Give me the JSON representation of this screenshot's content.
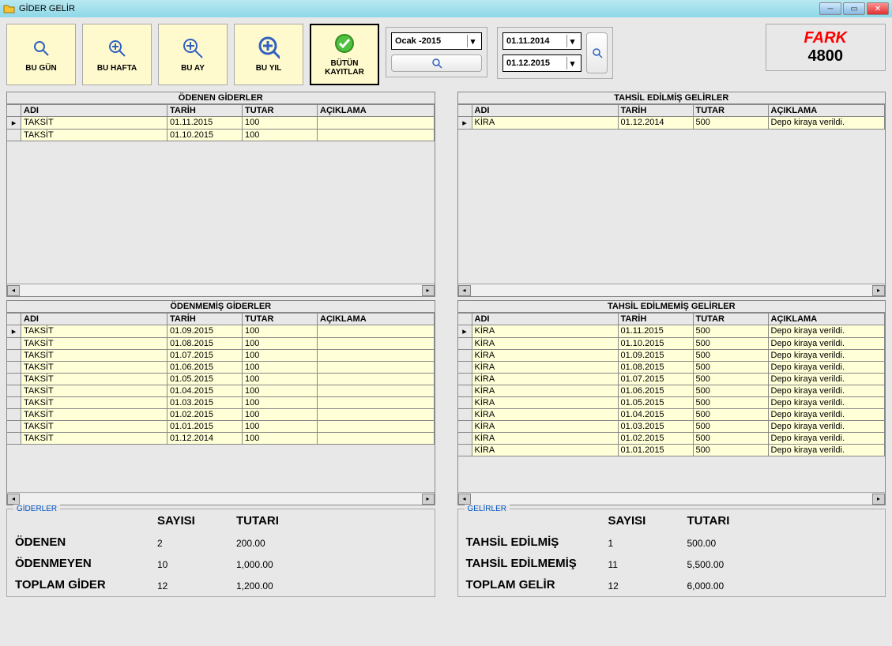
{
  "window": {
    "title": "GİDER GELİR"
  },
  "toolbar": {
    "bugun": "BU GÜN",
    "buhafta": "BU HAFTA",
    "buay": "BU AY",
    "buyil": "BU YIL",
    "butun": "BÜTÜN KAYITLAR"
  },
  "filters": {
    "month_year": "Ocak  -2015",
    "date_from": "01.11.2014",
    "date_to": "01.12.2015"
  },
  "fark": {
    "label": "FARK",
    "value": "4800"
  },
  "grid_headers": {
    "adi": "ADI",
    "tarih": "TARİH",
    "tutar": "TUTAR",
    "aciklama": "AÇIKLAMA"
  },
  "grids": {
    "odenen_giderler": {
      "title": "ÖDENEN GİDERLER",
      "rows": [
        {
          "adi": "TAKSİT",
          "tarih": "01.11.2015",
          "tutar": "100",
          "aciklama": ""
        },
        {
          "adi": "TAKSİT",
          "tarih": "01.10.2015",
          "tutar": "100",
          "aciklama": ""
        }
      ]
    },
    "tahsil_edilmis": {
      "title": "TAHSİL EDİLMİŞ GELİRLER",
      "rows": [
        {
          "adi": "KİRA",
          "tarih": "01.12.2014",
          "tutar": "500",
          "aciklama": "Depo kiraya verildi."
        }
      ]
    },
    "odenmemis_giderler": {
      "title": "ÖDENMEMİŞ GİDERLER",
      "rows": [
        {
          "adi": "TAKSİT",
          "tarih": "01.09.2015",
          "tutar": "100",
          "aciklama": ""
        },
        {
          "adi": "TAKSİT",
          "tarih": "01.08.2015",
          "tutar": "100",
          "aciklama": ""
        },
        {
          "adi": "TAKSİT",
          "tarih": "01.07.2015",
          "tutar": "100",
          "aciklama": ""
        },
        {
          "adi": "TAKSİT",
          "tarih": "01.06.2015",
          "tutar": "100",
          "aciklama": ""
        },
        {
          "adi": "TAKSİT",
          "tarih": "01.05.2015",
          "tutar": "100",
          "aciklama": ""
        },
        {
          "adi": "TAKSİT",
          "tarih": "01.04.2015",
          "tutar": "100",
          "aciklama": ""
        },
        {
          "adi": "TAKSİT",
          "tarih": "01.03.2015",
          "tutar": "100",
          "aciklama": ""
        },
        {
          "adi": "TAKSİT",
          "tarih": "01.02.2015",
          "tutar": "100",
          "aciklama": ""
        },
        {
          "adi": "TAKSİT",
          "tarih": "01.01.2015",
          "tutar": "100",
          "aciklama": ""
        },
        {
          "adi": "TAKSİT",
          "tarih": "01.12.2014",
          "tutar": "100",
          "aciklama": ""
        }
      ]
    },
    "tahsil_edilmemis": {
      "title": "TAHSİL EDİLMEMİŞ GELİRLER",
      "rows": [
        {
          "adi": "KİRA",
          "tarih": "01.11.2015",
          "tutar": "500",
          "aciklama": "Depo kiraya verildi."
        },
        {
          "adi": "KİRA",
          "tarih": "01.10.2015",
          "tutar": "500",
          "aciklama": "Depo kiraya verildi."
        },
        {
          "adi": "KİRA",
          "tarih": "01.09.2015",
          "tutar": "500",
          "aciklama": "Depo kiraya verildi."
        },
        {
          "adi": "KİRA",
          "tarih": "01.08.2015",
          "tutar": "500",
          "aciklama": "Depo kiraya verildi."
        },
        {
          "adi": "KİRA",
          "tarih": "01.07.2015",
          "tutar": "500",
          "aciklama": "Depo kiraya verildi."
        },
        {
          "adi": "KİRA",
          "tarih": "01.06.2015",
          "tutar": "500",
          "aciklama": "Depo kiraya verildi."
        },
        {
          "adi": "KİRA",
          "tarih": "01.05.2015",
          "tutar": "500",
          "aciklama": "Depo kiraya verildi."
        },
        {
          "adi": "KİRA",
          "tarih": "01.04.2015",
          "tutar": "500",
          "aciklama": "Depo kiraya verildi."
        },
        {
          "adi": "KİRA",
          "tarih": "01.03.2015",
          "tutar": "500",
          "aciklama": "Depo kiraya verildi."
        },
        {
          "adi": "KİRA",
          "tarih": "01.02.2015",
          "tutar": "500",
          "aciklama": "Depo kiraya verildi."
        },
        {
          "adi": "KİRA",
          "tarih": "01.01.2015",
          "tutar": "500",
          "aciklama": "Depo kiraya verildi."
        }
      ]
    }
  },
  "summary": {
    "giderler": {
      "legend": "GİDERLER",
      "cols": {
        "sayisi": "SAYISI",
        "tutari": "TUTARI"
      },
      "rows": {
        "odenen": {
          "label": "ÖDENEN",
          "sayisi": "2",
          "tutari": "200.00"
        },
        "odenmeyen": {
          "label": "ÖDENMEYEN",
          "sayisi": "10",
          "tutari": "1,000.00"
        },
        "toplam": {
          "label": "TOPLAM GİDER",
          "sayisi": "12",
          "tutari": "1,200.00"
        }
      }
    },
    "gelirler": {
      "legend": "GELİRLER",
      "cols": {
        "sayisi": "SAYISI",
        "tutari": "TUTARI"
      },
      "rows": {
        "edilmis": {
          "label": "TAHSİL EDİLMİŞ",
          "sayisi": "1",
          "tutari": "500.00"
        },
        "edilmemis": {
          "label": "TAHSİL EDİLMEMİŞ",
          "sayisi": "11",
          "tutari": "5,500.00"
        },
        "toplam": {
          "label": "TOPLAM GELİR",
          "sayisi": "12",
          "tutari": "6,000.00"
        }
      }
    }
  }
}
